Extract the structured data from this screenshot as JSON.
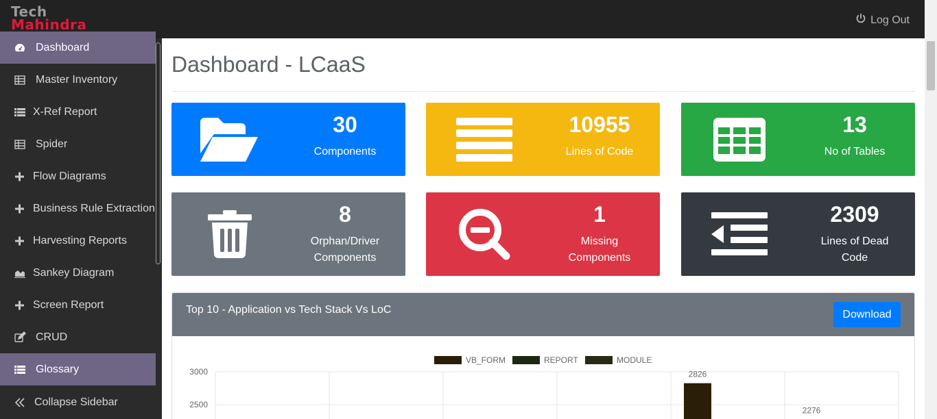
{
  "brand": {
    "line1": "Tech",
    "line2": "Mahindra"
  },
  "header": {
    "logout_label": "Log Out"
  },
  "sidebar": {
    "items": [
      {
        "label": "Dashboard",
        "icon": "gauge-icon",
        "active": true
      },
      {
        "label": "Master Inventory",
        "icon": "table-icon"
      },
      {
        "label": "X-Ref Report",
        "icon": "list-icon"
      },
      {
        "label": "Spider",
        "icon": "table-icon"
      },
      {
        "label": "Flow Diagrams",
        "icon": "plus-icon"
      },
      {
        "label": "Business Rule Extraction",
        "icon": "plus-icon"
      },
      {
        "label": "Harvesting Reports",
        "icon": "plus-icon"
      },
      {
        "label": "Sankey Diagram",
        "icon": "area-chart-icon"
      },
      {
        "label": "Screen Report",
        "icon": "plus-icon"
      },
      {
        "label": "CRUD",
        "icon": "edit-icon"
      },
      {
        "label": "Glossary",
        "icon": "list-icon",
        "active": true
      },
      {
        "label": "Collapse Sidebar",
        "icon": "double-chevron-left-icon"
      }
    ]
  },
  "main": {
    "title": "Dashboard - LCaaS",
    "cards": [
      {
        "value": "30",
        "label": "Components",
        "color": "#007bff",
        "icon": "folder-open-icon"
      },
      {
        "value": "10955",
        "label": "Lines of Code",
        "color": "#f5b811",
        "icon": "bars-icon"
      },
      {
        "value": "13",
        "label": "No of Tables",
        "color": "#28a745",
        "icon": "table-grid-icon"
      },
      {
        "value": "8",
        "label_line1": "Orphan/Driver",
        "label_line2": "Components",
        "color": "#6c757d",
        "icon": "trash-icon"
      },
      {
        "value": "1",
        "label_line1": "Missing",
        "label_line2": "Components",
        "color": "#dc3545",
        "icon": "search-minus-icon"
      },
      {
        "value": "2309",
        "label_line1": "Lines of Dead",
        "label_line2": "Code",
        "color": "#343a40",
        "icon": "outdent-icon"
      }
    ],
    "chart_panel": {
      "title": "Top 10 - Application vs Tech Stack Vs LoC",
      "download_label": "Download"
    }
  },
  "chart_data": {
    "type": "bar",
    "series": [
      {
        "name": "VB_FORM",
        "color": "#2a1e06"
      },
      {
        "name": "REPORT",
        "color": "#1e2810"
      },
      {
        "name": "MODULE",
        "color": "#282a14"
      }
    ],
    "ytick_labels": [
      "3000",
      "2500"
    ],
    "visible_bars": [
      {
        "series": "VB_FORM",
        "value": 2826,
        "label": "2826"
      },
      {
        "series": "VB_FORM",
        "value": 2276,
        "label": "2276"
      }
    ]
  }
}
